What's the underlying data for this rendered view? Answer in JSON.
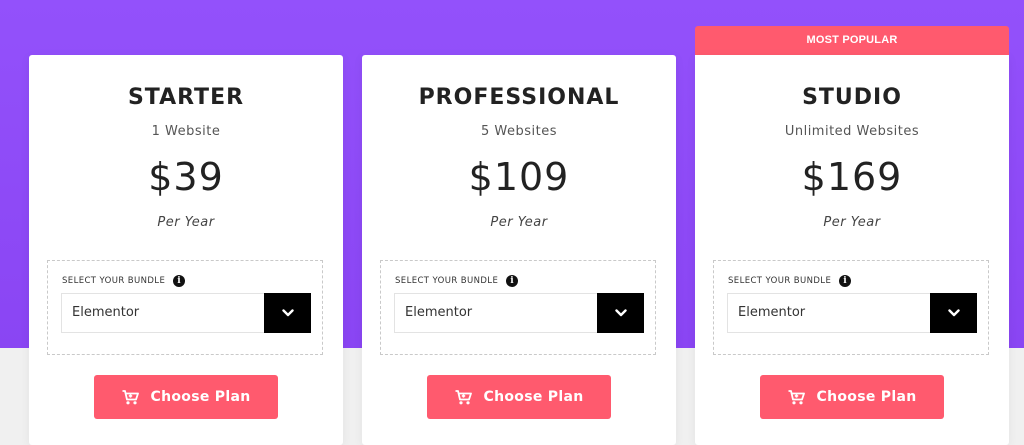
{
  "ribbon": {
    "label": "MOST POPULAR"
  },
  "plans": [
    {
      "name": "STARTER",
      "sites": "1 Website",
      "price": "$39",
      "period": "Per Year",
      "bundle_label": "SELECT YOUR BUNDLE",
      "bundle_value": "Elementor",
      "cta": "Choose Plan"
    },
    {
      "name": "PROFESSIONAL",
      "sites": "5 Websites",
      "price": "$109",
      "period": "Per Year",
      "bundle_label": "SELECT YOUR BUNDLE",
      "bundle_value": "Elementor",
      "cta": "Choose Plan"
    },
    {
      "name": "STUDIO",
      "sites": "Unlimited Websites",
      "price": "$169",
      "period": "Per Year",
      "bundle_label": "SELECT YOUR BUNDLE",
      "bundle_value": "Elementor",
      "cta": "Choose Plan"
    }
  ],
  "colors": {
    "background_purple": "#9351fb",
    "accent_coral": "#ff5a6e",
    "dropdown_button": "#000000"
  },
  "icons": {
    "info": "info-icon",
    "dropdown": "chevron-down-icon",
    "cart": "cart-icon"
  }
}
